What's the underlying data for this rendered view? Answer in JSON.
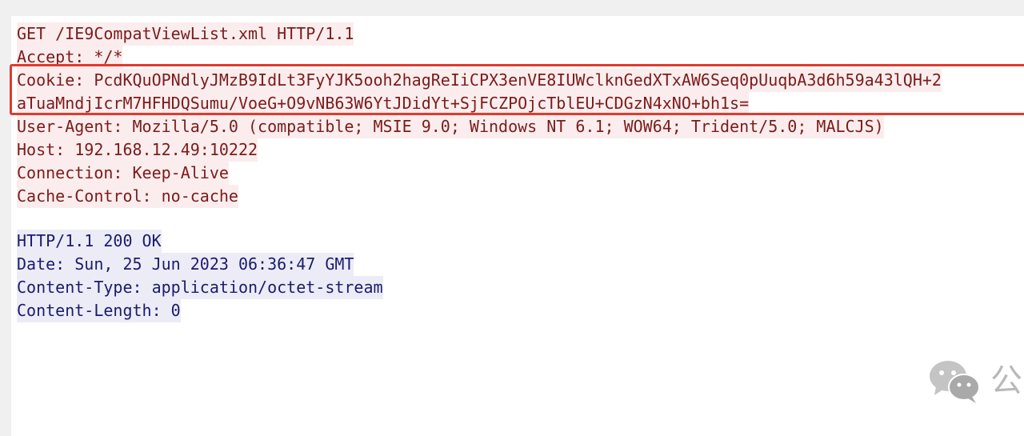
{
  "request": {
    "lines": [
      "GET /IE9CompatViewList.xml HTTP/1.1",
      "Accept: */*",
      "Cookie: PcdKQuOPNdlyJMzB9IdLt3FyYJK5ooh2hagReIiCPX3enVE8IUWclknGedXTxAW6Seq0pUuqbA3d6h59a43lQH+2",
      "aTuaMndjIcrM7HFHDQSumu/VoeG+O9vNB63W6YtJDidYt+SjFCZPOjcTblEU+CDGzN4xNO+bh1s=",
      "User-Agent: Mozilla/5.0 (compatible; MSIE 9.0; Windows NT 6.1; WOW64; Trident/5.0; MALCJS)",
      "Host: 192.168.12.49:10222",
      "Connection: Keep-Alive",
      "Cache-Control: no-cache"
    ]
  },
  "response": {
    "lines": [
      "HTTP/1.1 200 OK",
      "Date: Sun, 25 Jun 2023 06:36:47 GMT",
      "Content-Type: application/octet-stream",
      "Content-Length: 0"
    ]
  },
  "watermark": {
    "icon": "wechat-icon",
    "text": "公"
  },
  "colors": {
    "request_text": "#7b1b1b",
    "request_bg": "#fbeded",
    "response_text": "#1b1b6e",
    "response_bg": "#ececf7",
    "highlight_border": "#e03a2e"
  }
}
